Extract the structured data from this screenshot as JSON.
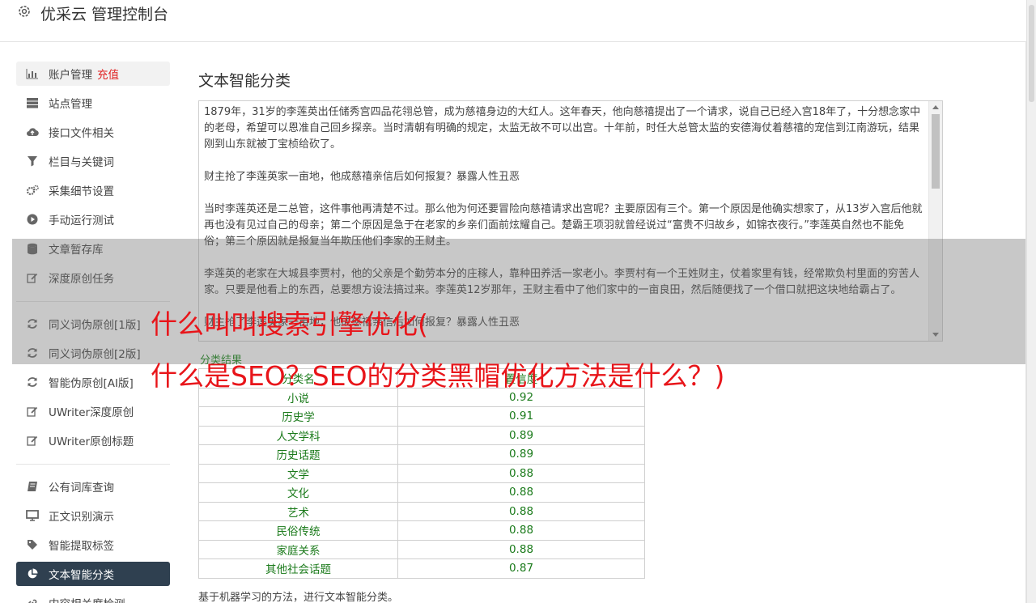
{
  "header": {
    "title": "优采云 管理控制台",
    "icon": "gear-icon"
  },
  "sidebar": {
    "items": [
      {
        "label": "账户管理",
        "badge": "充值",
        "icon": "bar-chart-icon"
      },
      {
        "label": "站点管理",
        "icon": "server-icon"
      },
      {
        "label": "接口文件相关",
        "icon": "cloud-upload-icon"
      },
      {
        "label": "栏目与关键词",
        "icon": "filter-icon"
      },
      {
        "label": "采集细节设置",
        "icon": "gears-icon"
      },
      {
        "label": "手动运行测试",
        "icon": "play-circle-icon"
      },
      {
        "label": "文章暂存库",
        "icon": "database-icon"
      },
      {
        "label": "深度原创任务",
        "icon": "edit-icon"
      },
      {
        "label": "同义词伪原创[1版]",
        "icon": "refresh-icon"
      },
      {
        "label": "同义词伪原创[2版]",
        "icon": "refresh-icon"
      },
      {
        "label": "智能伪原创[AI版]",
        "icon": "refresh-icon"
      },
      {
        "label": "UWriter深度原创",
        "icon": "edit-icon"
      },
      {
        "label": "UWriter原创标题",
        "icon": "edit-icon"
      },
      {
        "label": "公有词库查询",
        "icon": "book-icon"
      },
      {
        "label": "正文识别演示",
        "icon": "monitor-icon"
      },
      {
        "label": "智能提取标签",
        "icon": "tag-icon"
      },
      {
        "label": "文本智能分类",
        "icon": "pie-chart-icon"
      },
      {
        "label": "内容相关度检测",
        "icon": "link-icon"
      }
    ]
  },
  "main": {
    "title": "文本智能分类",
    "input_text": "1879年，31岁的李莲英出任储秀宫四品花翎总管，成为慈禧身边的大红人。这年春天，他向慈禧提出了一个请求，说自己已经入宫18年了，十分想念家中的老母，希望可以恩准自己回乡探亲。当时清朝有明确的规定，太监无故不可以出宫。十年前，时任大总管太监的安德海仗着慈禧的宠信到江南游玩，结果刚到山东就被丁宝桢给砍了。\n\n财主抢了李莲英家一亩地，他成慈禧亲信后如何报复？暴露人性丑恶\n\n当时李莲英还是二总管，这件事他再清楚不过。那么他为何还要冒险向慈禧请求出宫呢？主要原因有三个。第一个原因是他确实想家了，从13岁入宫后他就再也没有见过自己的母亲；第二个原因是急于在老家的乡亲们面前炫耀自己。楚霸王项羽就曾经说过“富贵不归故乡，如锦衣夜行。”李莲英自然也不能免俗；第三个原因就是报复当年欺压他们李家的王财主。\n\n李莲英的老家在大城县李贾村，他的父亲是个勤劳本分的庄稼人，靠种田养活一家老小。李贾村有一个王姓财主，仗着家里有钱，经常欺负村里面的穷苦人家。只要是他看上的东西，总要想方设法搞过来。李莲英12岁那年，王财主看中了他们家中的一亩良田，然后随便找了一个借口就把这块地给霸占了。\n\n财主抢了李莲英家一亩地，他成慈禧亲信后如何报复？暴露人性丑恶",
    "result_label": "分类结果",
    "overlay_headline_1": "什么叫叫搜索引擎优化(",
    "overlay_headline_2": "什么是SEO？SEO的分类黑帽优化方法是什么？)",
    "table": {
      "headers": [
        "分类名",
        "置信度"
      ],
      "rows": [
        [
          "小说",
          "0.92"
        ],
        [
          "历史学",
          "0.91"
        ],
        [
          "人文学科",
          "0.89"
        ],
        [
          "历史话题",
          "0.89"
        ],
        [
          "文学",
          "0.88"
        ],
        [
          "文化",
          "0.88"
        ],
        [
          "艺术",
          "0.88"
        ],
        [
          "民俗传统",
          "0.88"
        ],
        [
          "家庭关系",
          "0.88"
        ],
        [
          "其他社会话题",
          "0.87"
        ]
      ]
    },
    "footnote": "基于机器学习的方法，进行文本智能分类。"
  },
  "colors": {
    "active_nav": "#2f4050",
    "recharge": "#e02020",
    "result_green": "#1a7a1a",
    "headline_red": "#e8151a"
  }
}
